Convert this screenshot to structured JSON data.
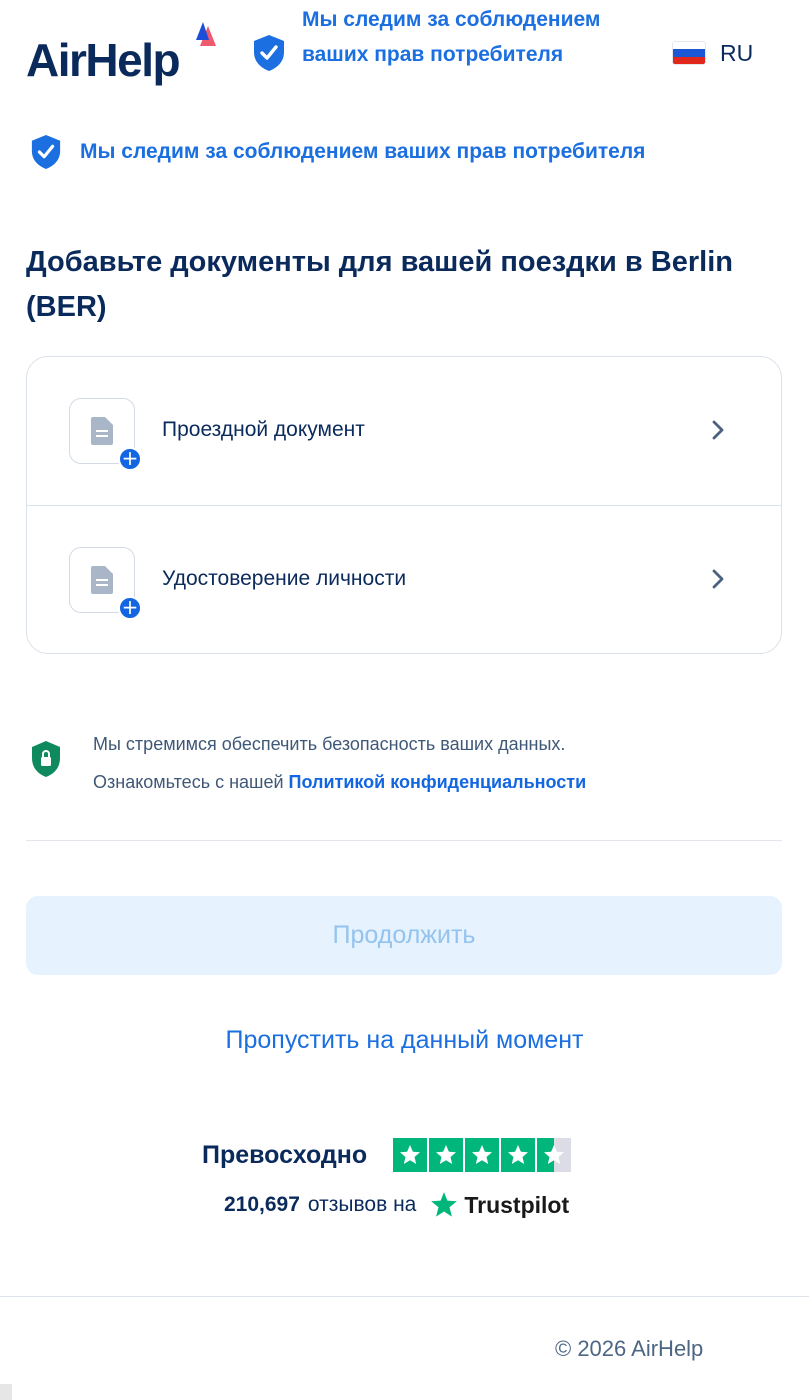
{
  "header": {
    "logo_text": "AirHelp",
    "tagline": "Мы следим за соблюдением ваших прав потребителя",
    "language": {
      "code": "RU",
      "flag": "russia-flag"
    }
  },
  "trust_banner": {
    "text": "Мы следим за соблюдением ваших прав потребителя"
  },
  "page_title": "Добавьте документы для вашей поездки в Berlin (BER)",
  "documents": [
    {
      "label": "Проездной документ",
      "icon": "document-icon"
    },
    {
      "label": "Удостоверение личности",
      "icon": "document-icon"
    }
  ],
  "privacy": {
    "line1": "Мы стремимся обеспечить безопасность ваших данных.",
    "line2_prefix": "Ознакомьтесь с нашей ",
    "link_text": "Политикой конфиденциальности"
  },
  "actions": {
    "continue_label": "Продолжить",
    "skip_label": "Пропустить на данный момент"
  },
  "trustpilot": {
    "rating_label": "Превосходно",
    "stars": 4.5,
    "review_count": "210,697",
    "reviews_on": "отзывов на",
    "brand": "Trustpilot"
  },
  "footer": {
    "copyright": "© 2026 AirHelp"
  },
  "colors": {
    "brand_navy": "#0b2a5c",
    "link_blue": "#1b6fe0",
    "button_disabled_bg": "#e6f2fd",
    "button_disabled_text": "#93c3ef",
    "trustpilot_green": "#00b67a",
    "privacy_green": "#0f8a5f"
  }
}
